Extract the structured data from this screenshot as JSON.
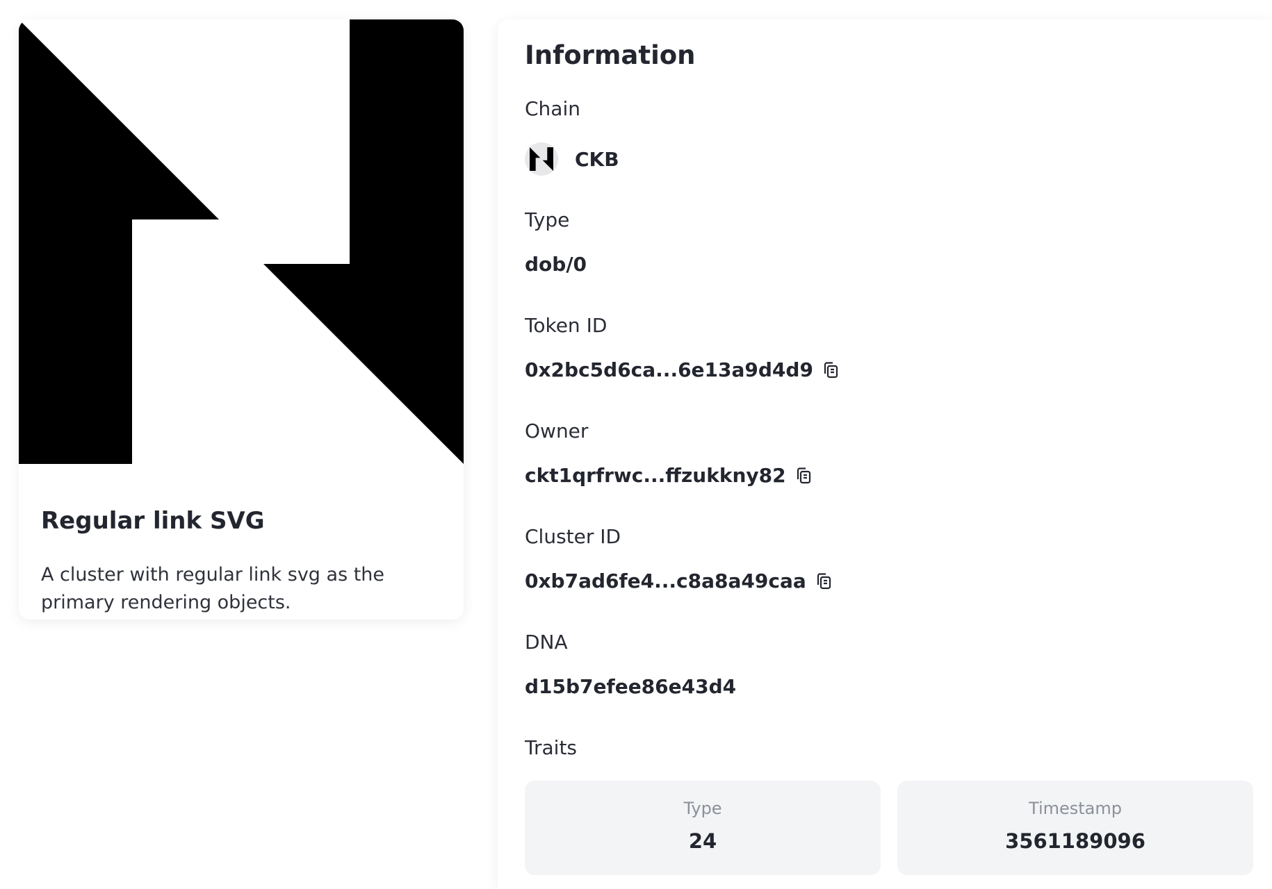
{
  "nft": {
    "title": "Regular link SVG",
    "description": "A cluster with regular link svg as the primary rendering objects.",
    "art_icon": "ckb-logo-art"
  },
  "info": {
    "heading": "Information",
    "chain": {
      "label": "Chain",
      "value": "CKB",
      "icon": "ckb-logo-icon"
    },
    "type": {
      "label": "Type",
      "value": "dob/0"
    },
    "token_id": {
      "label": "Token ID",
      "value": "0x2bc5d6ca...6e13a9d4d9"
    },
    "owner": {
      "label": "Owner",
      "value": "ckt1qrfrwc...ffzukkny82"
    },
    "cluster_id": {
      "label": "Cluster ID",
      "value": "0xb7ad6fe4...c8a8a49caa"
    },
    "dna": {
      "label": "DNA",
      "value": "d15b7efee86e43d4"
    },
    "traits": {
      "label": "Traits",
      "items": [
        {
          "name": "Type",
          "value": "24"
        },
        {
          "name": "Timestamp",
          "value": "3561189096"
        }
      ]
    }
  },
  "colors": {
    "text": "#23262f",
    "muted": "#8c9099",
    "trait_bg": "#f3f4f6"
  }
}
